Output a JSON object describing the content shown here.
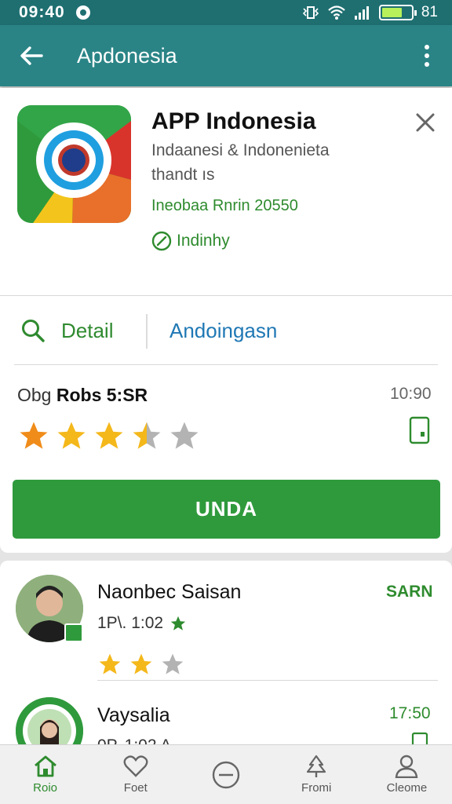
{
  "status_bar": {
    "time": "09:40",
    "battery_level": 0.7,
    "battery_text": "81"
  },
  "app_bar": {
    "title": "Apdonesia"
  },
  "app": {
    "name": "APP Indonesia",
    "developer_line1": "Indaanesi & Indonenieta",
    "developer_line2": "thandt ıs",
    "meta": "Ineobaa Rnrin 20550",
    "badge": "Indinhy"
  },
  "tabs": [
    {
      "label": "Detail"
    },
    {
      "label": "Andoingasn"
    }
  ],
  "rating": {
    "label_prefix": "Obg",
    "label_strong": "Robs 5:SR",
    "time": "10:90",
    "stars": 3.5,
    "max_stars": 5
  },
  "install_button": {
    "label": "UNDA"
  },
  "reviews": [
    {
      "name": "Naonbec Saisan",
      "date": "1P\\. 1:02",
      "action": "SARN",
      "stars": 2,
      "max_stars": 3
    },
    {
      "name": "Vaysalia",
      "date": "0P. 1:02 A",
      "action": "17:50"
    }
  ],
  "bottom_nav": [
    {
      "label": "Roio",
      "icon": "home-icon",
      "active": true
    },
    {
      "label": "Foet",
      "icon": "heart-icon"
    },
    {
      "label": "",
      "icon": "minus-circle-icon"
    },
    {
      "label": "Fromi",
      "icon": "tree-icon"
    },
    {
      "label": "Cleome",
      "icon": "profile-icon"
    }
  ],
  "colors": {
    "primary": "#2a8486",
    "accent_green": "#2f9a3c",
    "link_blue": "#1f78b4",
    "star": "#f4b81b"
  }
}
